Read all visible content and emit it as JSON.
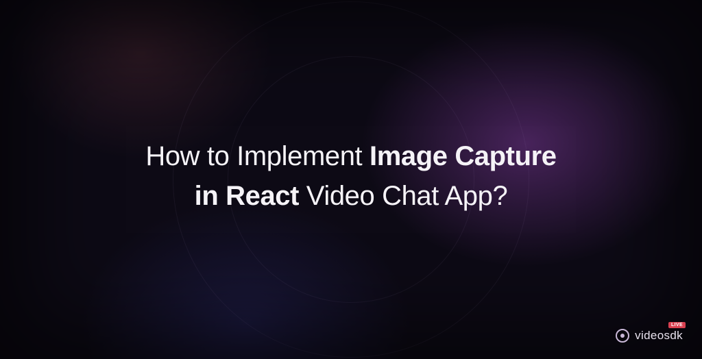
{
  "title": {
    "line1_part1": "How to Implement ",
    "line1_part2": "Image Capture",
    "line2_part1": "in React",
    "line2_part2": " Video Chat App?"
  },
  "logo": {
    "brand": "videosdk",
    "badge": "LIVE"
  }
}
